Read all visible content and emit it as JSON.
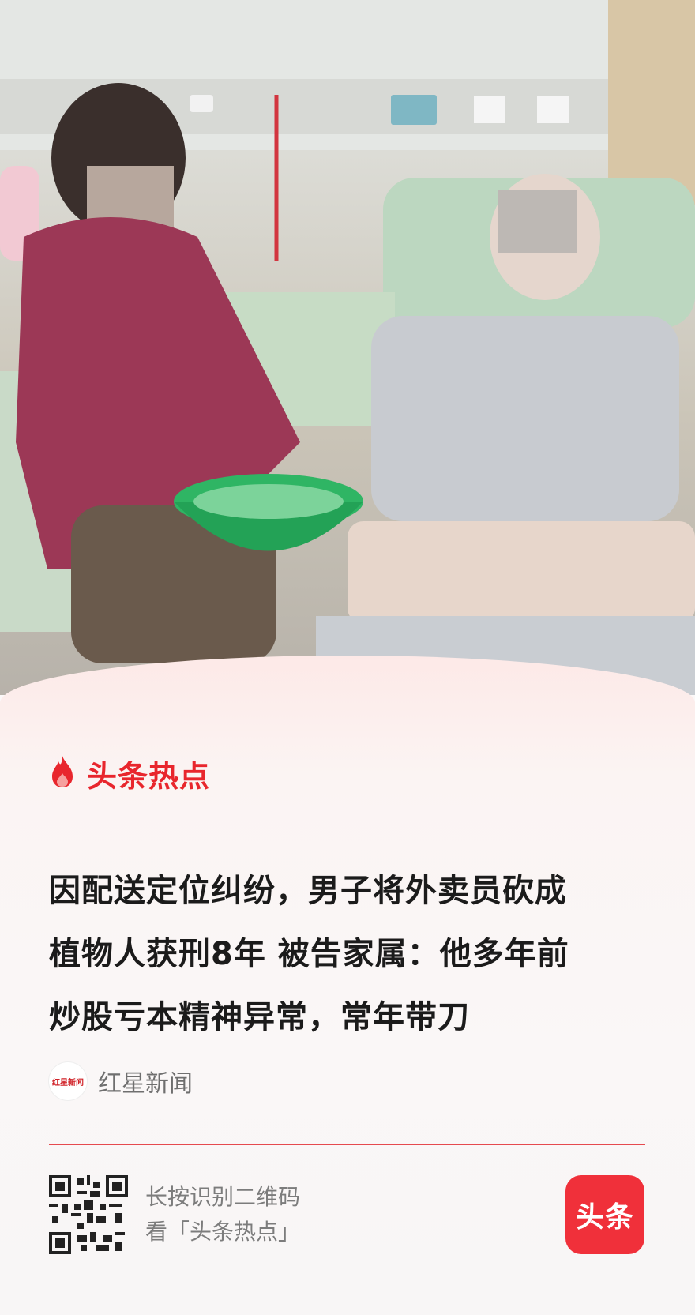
{
  "brand": {
    "name": "头条热点",
    "icon": "flame-icon",
    "accent": "#e8262d"
  },
  "headline": {
    "line1": "因配送定位纠纷，男子将外卖员砍成",
    "line2": "植物人获刑8年 被告家属：他多年前",
    "line3": "炒股亏本精神异常，常年带刀"
  },
  "source": {
    "name": "红星新闻",
    "logo_text": "红星新闻"
  },
  "footer": {
    "qr_line1": "长按识别二维码",
    "qr_line2": "看「头条热点」",
    "app_label": "头条",
    "app_color": "#f0303a"
  }
}
